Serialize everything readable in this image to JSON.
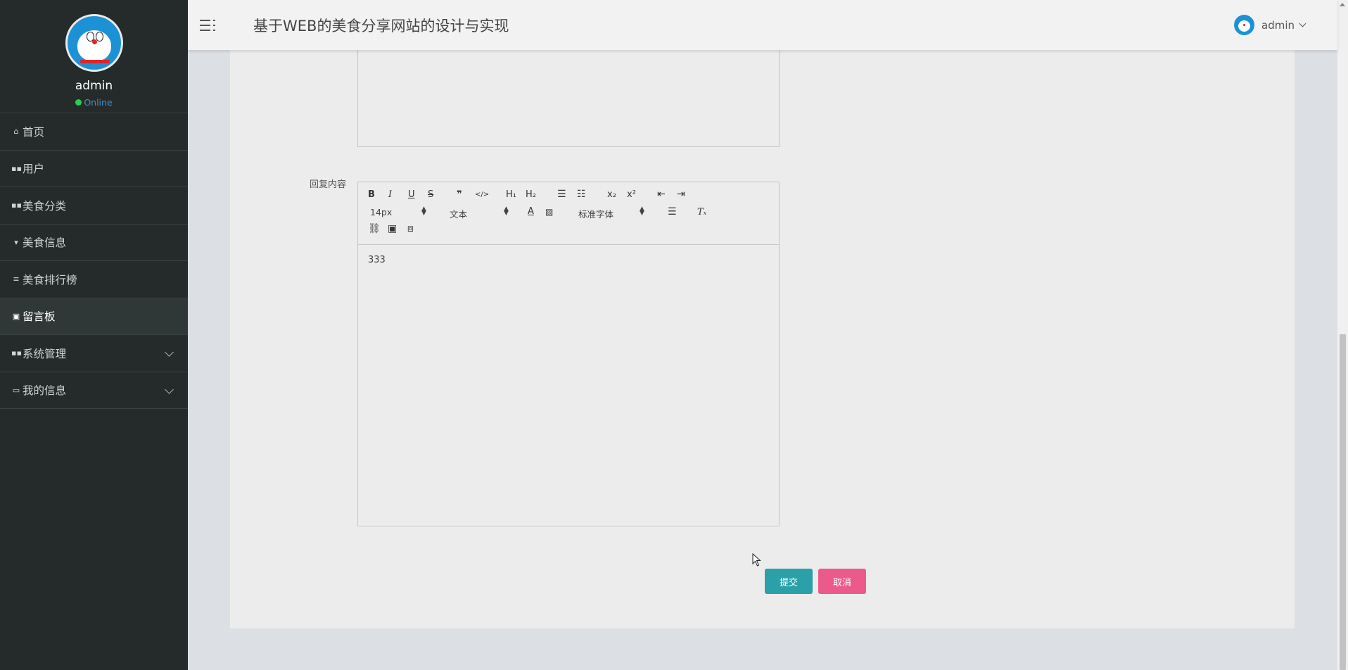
{
  "profile": {
    "name": "admin",
    "status": "Online"
  },
  "nav": {
    "items": [
      {
        "label": "首页",
        "icon": "home-icon"
      },
      {
        "label": "用户",
        "icon": "grid-icon"
      },
      {
        "label": "美食分类",
        "icon": "grid-icon"
      },
      {
        "label": "美食信息",
        "icon": "pin-icon"
      },
      {
        "label": "美食排行榜",
        "icon": "list-icon"
      },
      {
        "label": "留言板",
        "icon": "clipboard-icon",
        "active": true
      },
      {
        "label": "系统管理",
        "icon": "grid-icon",
        "expandable": true
      },
      {
        "label": "我的信息",
        "icon": "card-icon",
        "expandable": true
      }
    ]
  },
  "header": {
    "title": "基于WEB的美食分享网站的设计与实现",
    "user": "admin"
  },
  "form": {
    "reply_label": "回复内容",
    "reply_value": "333",
    "font_size": "14px",
    "paragraph": "文本",
    "font_family": "标准字体",
    "submit_label": "提交",
    "cancel_label": "取消"
  },
  "toolbar": {
    "bold": "B",
    "italic": "I",
    "underline": "U",
    "strike": "S",
    "quote": "❞",
    "code": "</>",
    "h1": "H₁",
    "h2": "H₂",
    "subscript": "x₂",
    "superscript": "x²",
    "clear": "Tₓ"
  },
  "colors": {
    "sidebar": "#252b2b",
    "submit": "#2ba0a8",
    "cancel": "#ec5a8b",
    "header": "#f2f2f2"
  }
}
